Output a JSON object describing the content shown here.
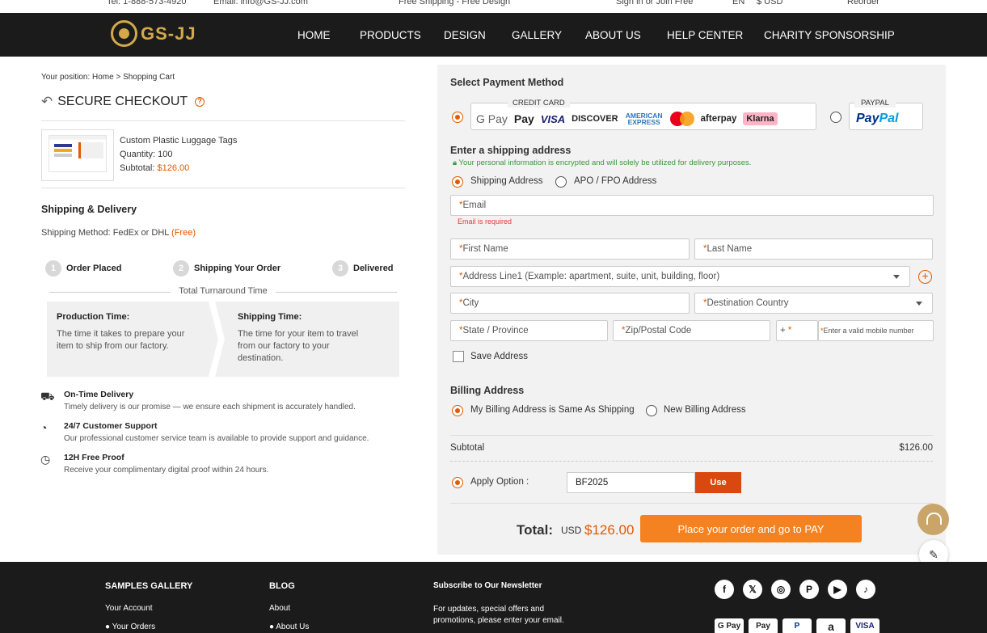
{
  "topbar": {
    "phone": "Tel: 1-888-573-4920",
    "email": "Email: info@GS-JJ.com",
    "promo": "Free Shipping - Free Design",
    "signin": "Sign in or Join Free",
    "lang": "EN",
    "currency": "$ USD",
    "reorder": "Reorder"
  },
  "header": {
    "logo_text": "GS-JJ",
    "nav": [
      "HOME",
      "PRODUCTS",
      "DESIGN",
      "GALLERY",
      "ABOUT US",
      "HELP CENTER",
      "CHARITY SPONSORSHIP"
    ]
  },
  "breadcrumb": "Your position: Home > Shopping Cart",
  "checkout_title": "SECURE CHECKOUT",
  "product": {
    "name": "Custom Plastic Luggage Tags",
    "quantity": "Quantity: 100",
    "subtotal_label": "Subtotal:",
    "subtotal_value": "$126.00"
  },
  "shipping": {
    "title": "Shipping & Delivery",
    "method_label": "Shipping Method:",
    "method_value": "FedEx or DHL",
    "method_price": "(Free)",
    "steps": [
      {
        "num": "1",
        "label": "Order Placed"
      },
      {
        "num": "2",
        "label": "Shipping Your Order"
      },
      {
        "num": "3",
        "label": "Delivered"
      }
    ],
    "turnaround": "Total Turnaround Time",
    "production_title": "Production Time:",
    "production_desc": "The time it takes to prepare your item to ship from our factory.",
    "shipping_title": "Shipping Time:",
    "shipping_desc": "The time for your item to travel from our factory to your destination."
  },
  "features": [
    {
      "title": "On-Time Delivery",
      "desc": "Timely delivery is our promise — we ensure each shipment is accurately handled."
    },
    {
      "title": "24/7 Customer Support",
      "desc": "Our professional customer service team is available to provide support and guidance."
    },
    {
      "title": "12H Free Proof",
      "desc": "Receive your complimentary digital proof within 24 hours."
    }
  ],
  "payment": {
    "title": "Select Payment Method",
    "credit_label": "CREDIT CARD",
    "paypal_label": "PAYPAL",
    "logos": [
      "G Pay",
      " Pay",
      "VISA",
      "DISCOVER",
      "AMERICAN EXPRESS",
      "afterpay",
      "Klarna"
    ],
    "paypal_logo_a": "Pay",
    "paypal_logo_b": "Pal"
  },
  "address": {
    "title": "Enter a shipping address",
    "secure_note": "Your personal information is encrypted and will solely be utilized for delivery purposes.",
    "opt_shipping": "Shipping Address",
    "opt_apo": "APO / FPO Address",
    "email_ph": "Email",
    "email_error": "Email is required",
    "first_name_ph": "First Name",
    "last_name_ph": "Last Name",
    "address1_ph": "Address Line1 (Example: apartment, suite, unit, building, floor)",
    "city_ph": "City",
    "country_ph": "Destination Country",
    "state_ph": "State / Province",
    "zip_ph": "Zip/Postal Code",
    "phone_code": "+",
    "phone_ph": "Enter a valid mobile number",
    "save_label": "Save Address"
  },
  "billing": {
    "title": "Billing Address",
    "opt_same": "My Billing Address is Same As Shipping",
    "opt_new": "New Billing Address"
  },
  "summary": {
    "subtotal_label": "Subtotal",
    "subtotal_value": "$126.00",
    "apply_label": "Apply Option :",
    "coupon_value": "BF2025",
    "use_label": "Use",
    "total_label": "Total:",
    "total_currency": "USD",
    "total_value": "$126.00",
    "pay_button": "Place your order and go to PAY"
  },
  "footer": {
    "col1_title": "SAMPLES GALLERY",
    "col1_link1": "Your Account",
    "col1_link2": "● Your Orders",
    "col2_title": "BLOG",
    "col2_link1": "About",
    "col2_link2": "● About Us",
    "newsletter_title": "Subscribe to Our Newsletter",
    "newsletter_desc": "For updates, special offers and promotions, please enter your email.",
    "social": [
      "f",
      "𝕏",
      "◎",
      "P",
      "▶",
      "♪"
    ],
    "pay_logos": [
      "G Pay",
      " Pay",
      "P",
      "a",
      "VISA"
    ]
  }
}
